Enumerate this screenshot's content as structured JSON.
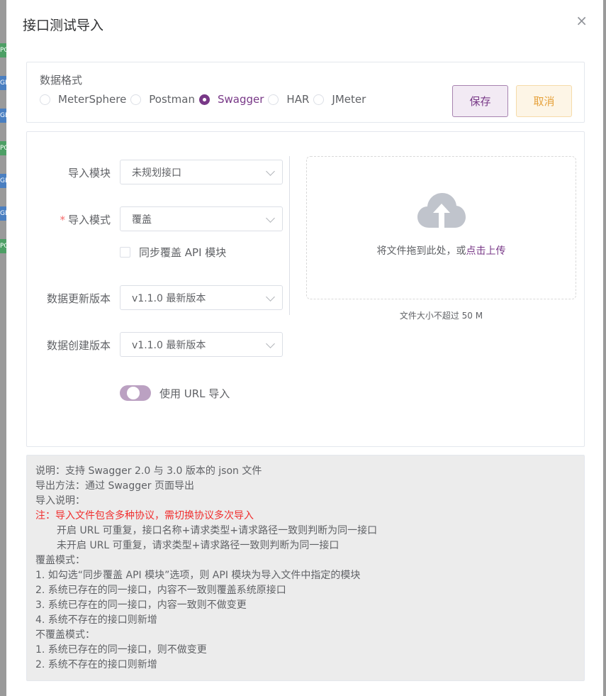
{
  "backdrop": {
    "tags": [
      {
        "text": "PO",
        "color": "green"
      },
      {
        "text": "GE",
        "color": "blue"
      },
      {
        "text": "GE",
        "color": "blue"
      },
      {
        "text": "PO",
        "color": "green"
      },
      {
        "text": "GE",
        "color": "blue"
      },
      {
        "text": "GE",
        "color": "blue"
      },
      {
        "text": "PO",
        "color": "green"
      }
    ]
  },
  "dialog": {
    "title": "接口测试导入",
    "close_icon": "×"
  },
  "format": {
    "label": "数据格式",
    "options": [
      "MeterSphere",
      "Postman",
      "Swagger",
      "HAR",
      "JMeter"
    ],
    "selected": "Swagger"
  },
  "buttons": {
    "save": "保存",
    "cancel": "取消"
  },
  "form": {
    "module_label": "导入模块",
    "module_value": "未规划接口",
    "mode_label": "导入模式",
    "mode_required": "*",
    "mode_value": "覆盖",
    "sync_checkbox": "同步覆盖 API 模块",
    "update_version_label": "数据更新版本",
    "update_version_value": "v1.1.0 最新版本",
    "create_version_label": "数据创建版本",
    "create_version_value": "v1.1.0 最新版本",
    "url_switch_label": "使用 URL 导入",
    "url_switch_on": false
  },
  "upload": {
    "icon": "cloud-upload-icon",
    "text_prefix": "将文件拖到此处，或",
    "link": "点击上传",
    "tip": "文件大小不超过 50 M"
  },
  "notes": {
    "lines": [
      {
        "text": "说明：支持 Swagger 2.0 与 3.0 版本的 json 文件",
        "style": "normal"
      },
      {
        "text": "导出方法：通过 Swagger 页面导出",
        "style": "normal"
      },
      {
        "text": "导入说明：",
        "style": "normal"
      },
      {
        "text": "注：导入文件包含多种协议，需切换协议多次导入",
        "style": "red"
      },
      {
        "text": "开启 URL 可重复，接口名称+请求类型+请求路径一致则判断为同一接口",
        "style": "indent"
      },
      {
        "text": "未开启 URL 可重复，请求类型+请求路径一致则判断为同一接口",
        "style": "indent"
      },
      {
        "text": "覆盖模式：",
        "style": "normal"
      },
      {
        "text": "1. 如勾选“同步覆盖 API 模块”选项，则 API 模块为导入文件中指定的模块",
        "style": "normal"
      },
      {
        "text": "2. 系统已存在的同一接口，内容不一致则覆盖系统原接口",
        "style": "normal"
      },
      {
        "text": "3. 系统已存在的同一接口，内容一致则不做变更",
        "style": "normal"
      },
      {
        "text": "4. 系统不存在的接口则新增",
        "style": "normal"
      },
      {
        "text": "不覆盖模式：",
        "style": "normal"
      },
      {
        "text": "1. 系统已存在的同一接口，则不做变更",
        "style": "normal"
      },
      {
        "text": "2. 系统不存在的接口则新增",
        "style": "normal"
      }
    ]
  },
  "colors": {
    "primary": "#783887",
    "warning": "#e6a23c",
    "danger": "#f02f2f"
  }
}
